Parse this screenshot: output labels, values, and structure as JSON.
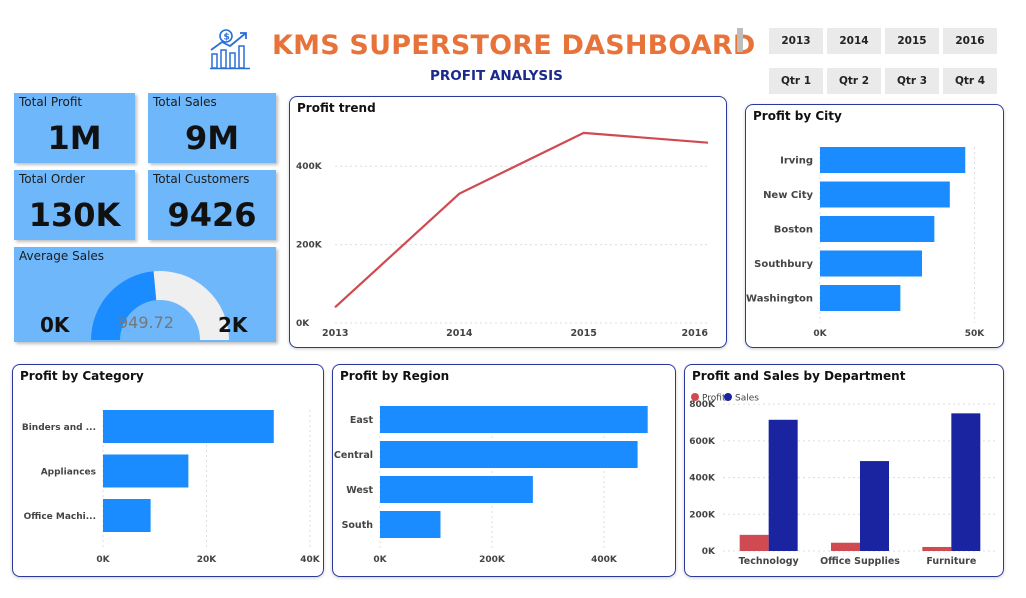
{
  "header": {
    "title": "KMS SUPERSTORE DASHBOARD",
    "subtitle": "PROFIT ANALYSIS",
    "logo_icon": "growth-chart-dollar-icon"
  },
  "slicers": {
    "years": [
      "2013",
      "2014",
      "2015",
      "2016"
    ],
    "quarters": [
      "Qtr 1",
      "Qtr 2",
      "Qtr 3",
      "Qtr 4"
    ]
  },
  "kpis": {
    "total_profit": {
      "label": "Total Profit",
      "value": "1M"
    },
    "total_sales": {
      "label": "Total Sales",
      "value": "9M"
    },
    "total_order": {
      "label": "Total Order",
      "value": "130K"
    },
    "total_customers": {
      "label": "Total Customers",
      "value": "9426"
    }
  },
  "average_sales": {
    "label": "Average Sales",
    "value": "949.72",
    "min_label": "0K",
    "max_label": "2K",
    "fraction": 0.47,
    "colors": {
      "fill": "#1A8CFF",
      "track": "#EFEFEF"
    }
  },
  "colors": {
    "accent": "#E8733A",
    "navy": "#1A2A8C",
    "bar": "#1A8CFF",
    "kpi_bg": "#6FB7FB",
    "line": "#D04A52",
    "profit": "#D04A52",
    "sales": "#1A23A0"
  },
  "chart_data": [
    {
      "id": "profit-trend",
      "type": "line",
      "title": "Profit trend",
      "x": [
        "2013",
        "2014",
        "2015",
        "2016"
      ],
      "values": [
        40000,
        330000,
        485000,
        460000
      ],
      "ylim": [
        0,
        500000
      ],
      "yticks": [
        {
          "v": 0,
          "label": "0K"
        },
        {
          "v": 200000,
          "label": "200K"
        },
        {
          "v": 400000,
          "label": "400K"
        }
      ]
    },
    {
      "id": "profit-by-city",
      "type": "bar",
      "orientation": "horizontal",
      "title": "Profit by City",
      "categories": [
        "Irving",
        "New City",
        "Boston",
        "Southbury",
        "Washington"
      ],
      "values": [
        47000,
        42000,
        37000,
        33000,
        26000
      ],
      "xlim": [
        0,
        55000
      ],
      "xticks": [
        {
          "v": 0,
          "label": "0K"
        },
        {
          "v": 50000,
          "label": "50K"
        }
      ]
    },
    {
      "id": "profit-by-category",
      "type": "bar",
      "orientation": "horizontal",
      "title": "Profit by Category",
      "categories": [
        "Binders and ...",
        "Appliances",
        "Office Machi..."
      ],
      "values": [
        33000,
        16500,
        9200
      ],
      "xlim": [
        0,
        40000
      ],
      "xticks": [
        {
          "v": 0,
          "label": "0K"
        },
        {
          "v": 20000,
          "label": "20K"
        },
        {
          "v": 40000,
          "label": "40K"
        }
      ]
    },
    {
      "id": "profit-by-region",
      "type": "bar",
      "orientation": "horizontal",
      "title": "Profit by Region",
      "categories": [
        "East",
        "Central",
        "West",
        "South"
      ],
      "values": [
        478000,
        460000,
        273000,
        108000
      ],
      "xlim": [
        0,
        500000
      ],
      "xticks": [
        {
          "v": 0,
          "label": "0K"
        },
        {
          "v": 200000,
          "label": "200K"
        },
        {
          "v": 400000,
          "label": "400K"
        }
      ]
    },
    {
      "id": "profit-sales-by-department",
      "type": "bar",
      "title": "Profit and Sales by Department",
      "categories": [
        "Technology",
        "Office Supplies",
        "Furniture"
      ],
      "series": [
        {
          "name": "Profit",
          "values": [
            88000,
            45000,
            22000
          ]
        },
        {
          "name": "Sales",
          "values": [
            715000,
            490000,
            750000
          ]
        }
      ],
      "ylim": [
        0,
        850000
      ],
      "yticks": [
        {
          "v": 0,
          "label": "0K"
        },
        {
          "v": 200000,
          "label": "200K"
        },
        {
          "v": 400000,
          "label": "400K"
        },
        {
          "v": 600000,
          "label": "600K"
        },
        {
          "v": 800000,
          "label": "800K"
        }
      ]
    }
  ]
}
